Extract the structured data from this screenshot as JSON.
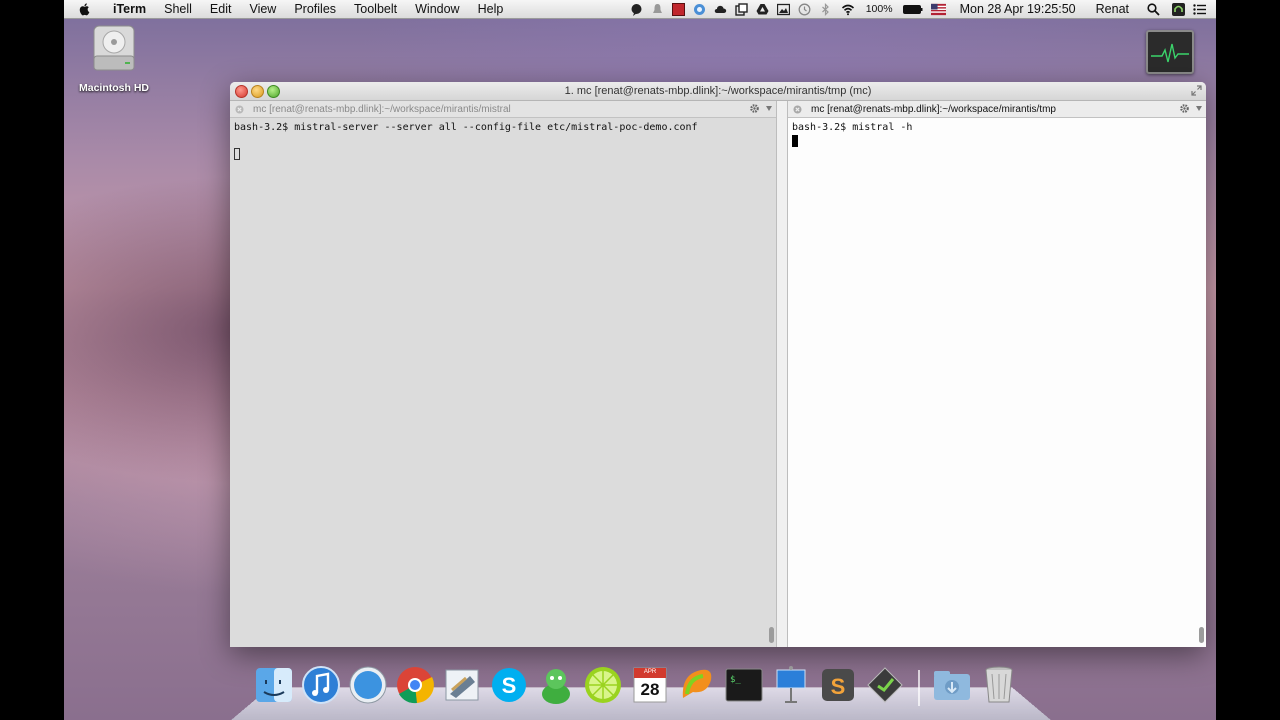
{
  "menubar": {
    "app_name": "iTerm",
    "menus": [
      "Shell",
      "Edit",
      "View",
      "Profiles",
      "Toolbelt",
      "Window",
      "Help"
    ],
    "battery": "100%",
    "datetime": "Mon 28 Apr  19:25:50",
    "user": "Renat"
  },
  "desktop": {
    "hd_label": "Macintosh HD"
  },
  "window": {
    "title": "1. mc [renat@renats-mbp.dlink]:~/workspace/mirantis/tmp (mc)",
    "left_pane": {
      "title": "mc [renat@renats-mbp.dlink]:~/workspace/mirantis/mistral",
      "lines": [
        "bash-3.2$ mistral-server --server all --config-file etc/mistral-poc-demo.conf"
      ]
    },
    "right_pane": {
      "title": "mc [renat@renats-mbp.dlink]:~/workspace/mirantis/tmp",
      "lines": [
        "bash-3.2$ mistral -h"
      ]
    }
  },
  "dock": {
    "calendar_day": "28",
    "calendar_month": "APR",
    "items": [
      "finder-icon",
      "itunes-icon",
      "safari-icon",
      "chrome-icon",
      "mail-icon",
      "skype-icon",
      "adium-icon",
      "limechat-icon",
      "calendar-icon",
      "pycharm-icon",
      "terminal-icon",
      "keynote-icon",
      "sublime-icon",
      "github-icon",
      "downloads-icon",
      "trash-icon"
    ]
  }
}
